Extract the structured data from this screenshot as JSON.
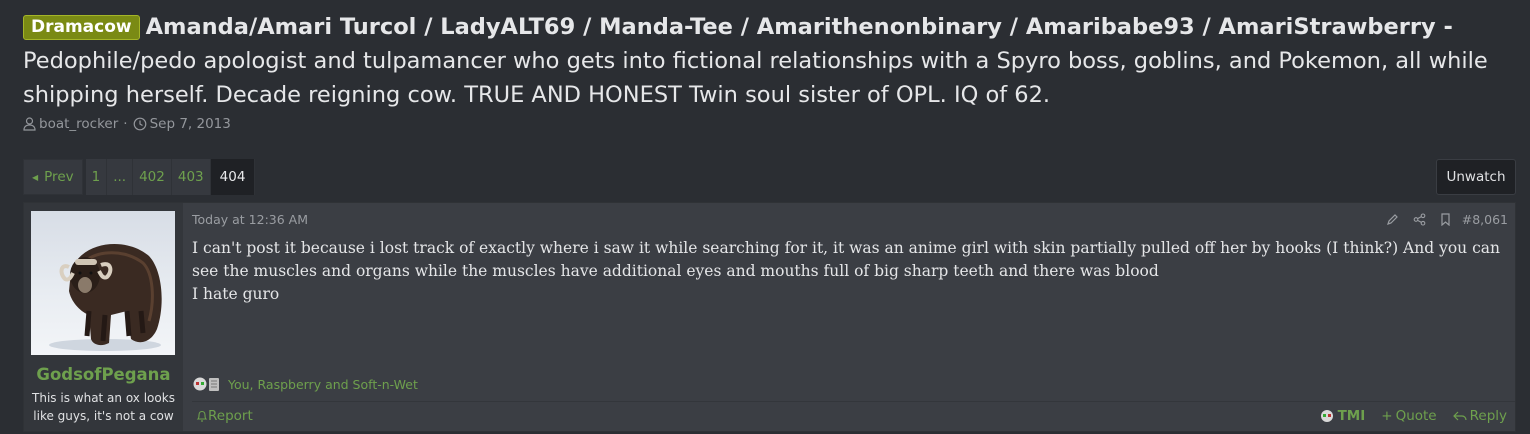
{
  "thread": {
    "prefix": "Dramacow",
    "title_names": "Amanda/Amari Turcol / LadyALT69 / Manda-Tee / Amarithenonbinary / Amaribabe93 / AmariStrawberry -",
    "title_rest": "Pedophile/pedo apologist and tulpamancer who gets into fictional relationships with a Spyro boss, goblins, and Pokemon, all while shipping herself. Decade reigning cow. TRUE AND HONEST Twin soul sister of OPL. IQ of 62.",
    "author": "boat_rocker",
    "date": "Sep 7, 2013"
  },
  "pagination": {
    "prev_label": "Prev",
    "pages": [
      "1",
      "...",
      "402",
      "403",
      "404"
    ],
    "current": "404"
  },
  "watch": {
    "label": "Unwatch"
  },
  "post": {
    "username": "GodsofPegana",
    "user_title": "This is what an ox looks like guys, it's not a cow",
    "date": "Today at 12:36 AM",
    "number": "#8,061",
    "body_line1": "I can't post it because i lost track of exactly where i saw it while searching for it, it was an anime girl with skin partially pulled off her by hooks (I think?) And you can see the muscles and organs while the muscles have additional eyes and mouths full of big sharp teeth and there was blood",
    "body_line2": "I hate guro",
    "reactions": "You, Raspberry and Soft-n-Wet",
    "report_label": "Report",
    "tmi_label": "TMI",
    "quote_label": "Quote",
    "reply_label": "Reply"
  },
  "colors": {
    "background": "#2b2e33",
    "panel": "#3b3e44",
    "link_green": "#6ea04d",
    "badge": "#7a8a14"
  },
  "icons": [
    "user-icon",
    "clock-icon",
    "edit-icon",
    "share-icon",
    "bookmark-icon",
    "flag-icon",
    "plus-icon",
    "reply-icon"
  ]
}
